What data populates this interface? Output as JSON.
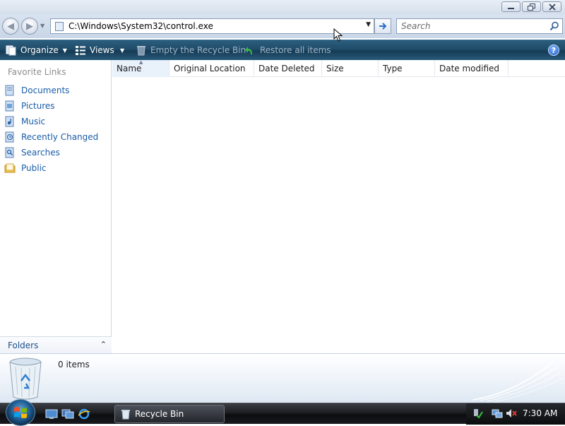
{
  "window": {
    "address": "C:\\Windows\\System32\\control.exe",
    "search_placeholder": "Search"
  },
  "toolbar": {
    "organize_label": "Organize",
    "views_label": "Views",
    "empty_label": "Empty the Recycle Bin",
    "restore_label": "Restore all items",
    "help_label": "?"
  },
  "navpane": {
    "title": "Favorite Links",
    "links": [
      {
        "label": "Documents",
        "icon": "documents-icon"
      },
      {
        "label": "Pictures",
        "icon": "pictures-icon"
      },
      {
        "label": "Music",
        "icon": "music-icon"
      },
      {
        "label": "Recently Changed",
        "icon": "recently-changed-icon"
      },
      {
        "label": "Searches",
        "icon": "searches-icon"
      },
      {
        "label": "Public",
        "icon": "public-folder-icon"
      }
    ],
    "folders_label": "Folders"
  },
  "content": {
    "columns": [
      "Name",
      "Original Location",
      "Date Deleted",
      "Size",
      "Type",
      "Date modified"
    ],
    "sorted_column": "Name"
  },
  "details": {
    "count_text": "0 items"
  },
  "taskbar": {
    "task_label": "Recycle Bin",
    "clock": "7:30 AM"
  },
  "colors": {
    "toolbar": "#1f4c69",
    "link": "#1b5da8",
    "taskbar": "#1c1e22"
  }
}
